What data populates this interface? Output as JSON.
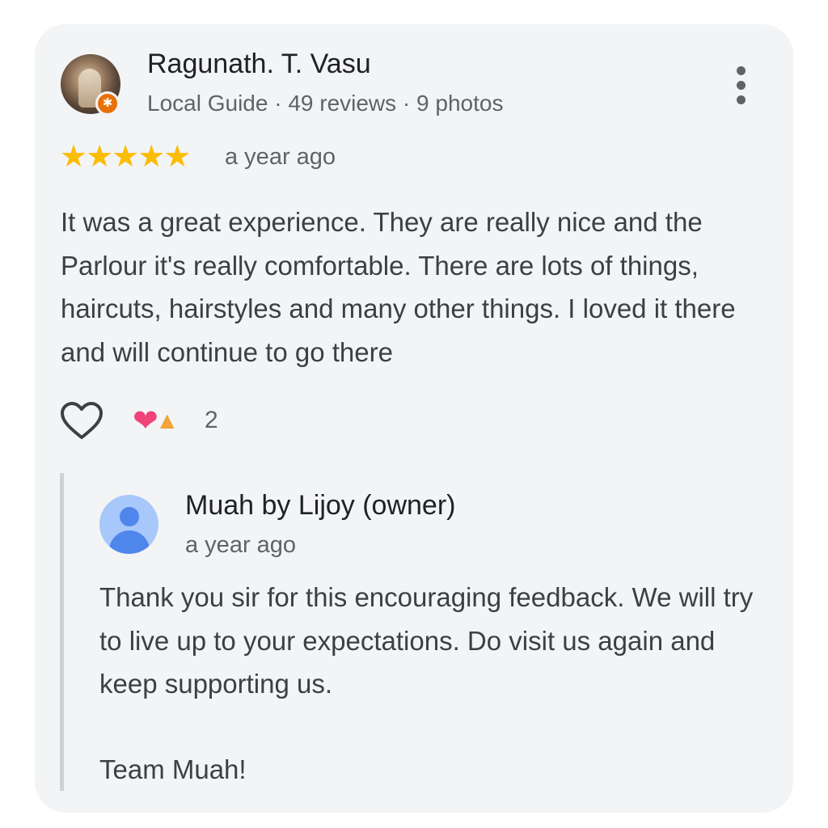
{
  "review": {
    "reviewer_name": "Ragunath. T. Vasu",
    "reviewer_meta": "Local Guide · 49 reviews · 9 photos",
    "rating": 5,
    "stars_text": "★★★★★",
    "time": "a year ago",
    "text": "It was a great experience. They are really nice and the Parlour it's really comfortable. There are lots of things, haircuts, hairstyles and many other things. I loved it there and will continue to go there",
    "reaction_count": "2",
    "reaction_icons": [
      "heart-emoji",
      "folded-hands-emoji"
    ]
  },
  "owner_reply": {
    "name": "Muah by Lijoy (owner)",
    "time": "a year ago",
    "text": "Thank you sir for this encouraging feedback. We will try to live up to your expectations. Do visit us again and keep supporting us.",
    "signoff": "Team Muah!"
  },
  "colors": {
    "card_background": "#f3f4f6",
    "star": "#fbbc04",
    "local_guide_badge": "#e8710a",
    "owner_avatar": "#a8c7fa"
  }
}
